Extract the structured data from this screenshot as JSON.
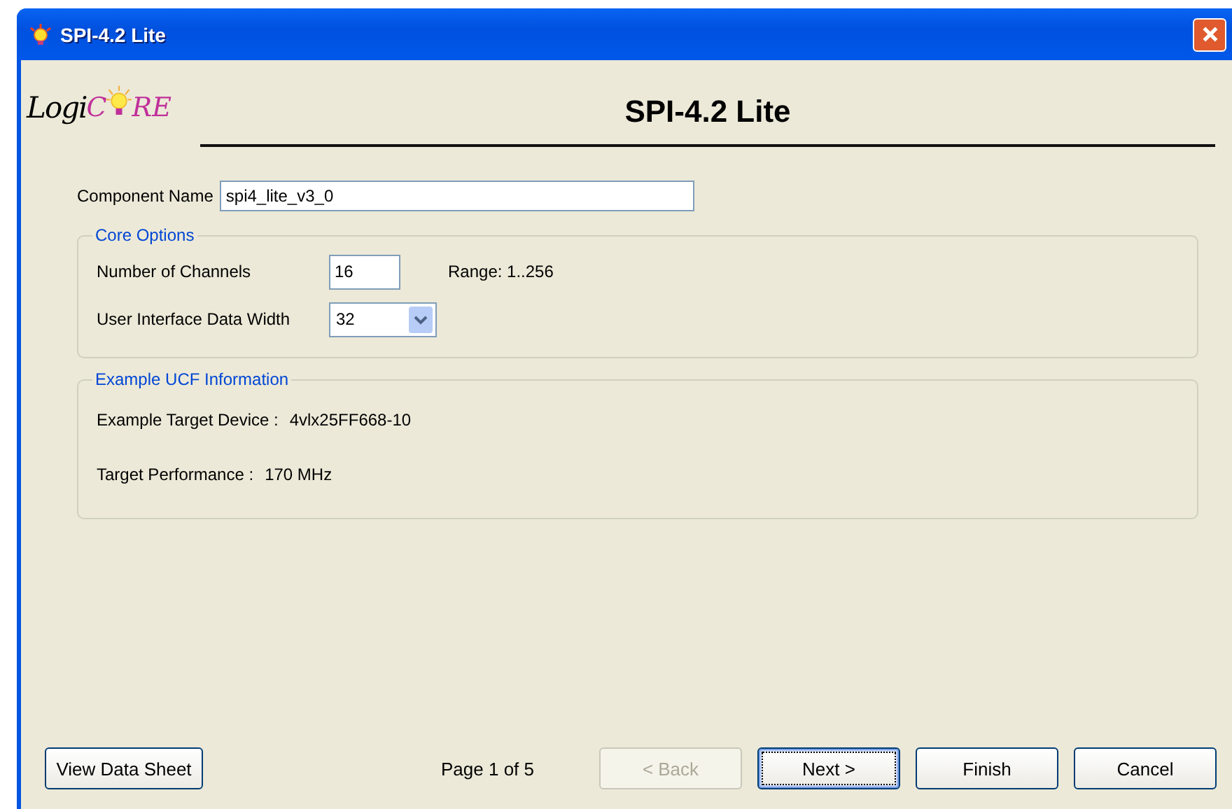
{
  "window": {
    "title": "SPI-4.2 Lite"
  },
  "logo": {
    "part_1": "Logi",
    "part_2": "C",
    "part_3": "RE"
  },
  "header": {
    "title": "SPI-4.2 Lite"
  },
  "component_name": {
    "label": "Component Name",
    "value": "spi4_lite_v3_0"
  },
  "core_options": {
    "title": "Core Options",
    "channels": {
      "label": "Number of Channels",
      "value": "16",
      "range": "Range: 1..256"
    },
    "data_width": {
      "label": "User Interface Data Width",
      "value": "32"
    }
  },
  "ucf_info": {
    "title": "Example UCF Information",
    "rows": [
      {
        "label": "Example Target Device :",
        "value": "4vlx25FF668-10"
      },
      {
        "label": "Target Performance :",
        "value": "170 MHz"
      }
    ]
  },
  "footer": {
    "data_sheet": "View Data Sheet",
    "page": "Page 1 of 5",
    "buttons": [
      {
        "label": "< Back",
        "disabled": true,
        "default": false
      },
      {
        "label": "Next >",
        "disabled": false,
        "default": true
      },
      {
        "label": "Finish",
        "disabled": false,
        "default": false
      },
      {
        "label": "Cancel",
        "disabled": false,
        "default": false
      }
    ]
  }
}
